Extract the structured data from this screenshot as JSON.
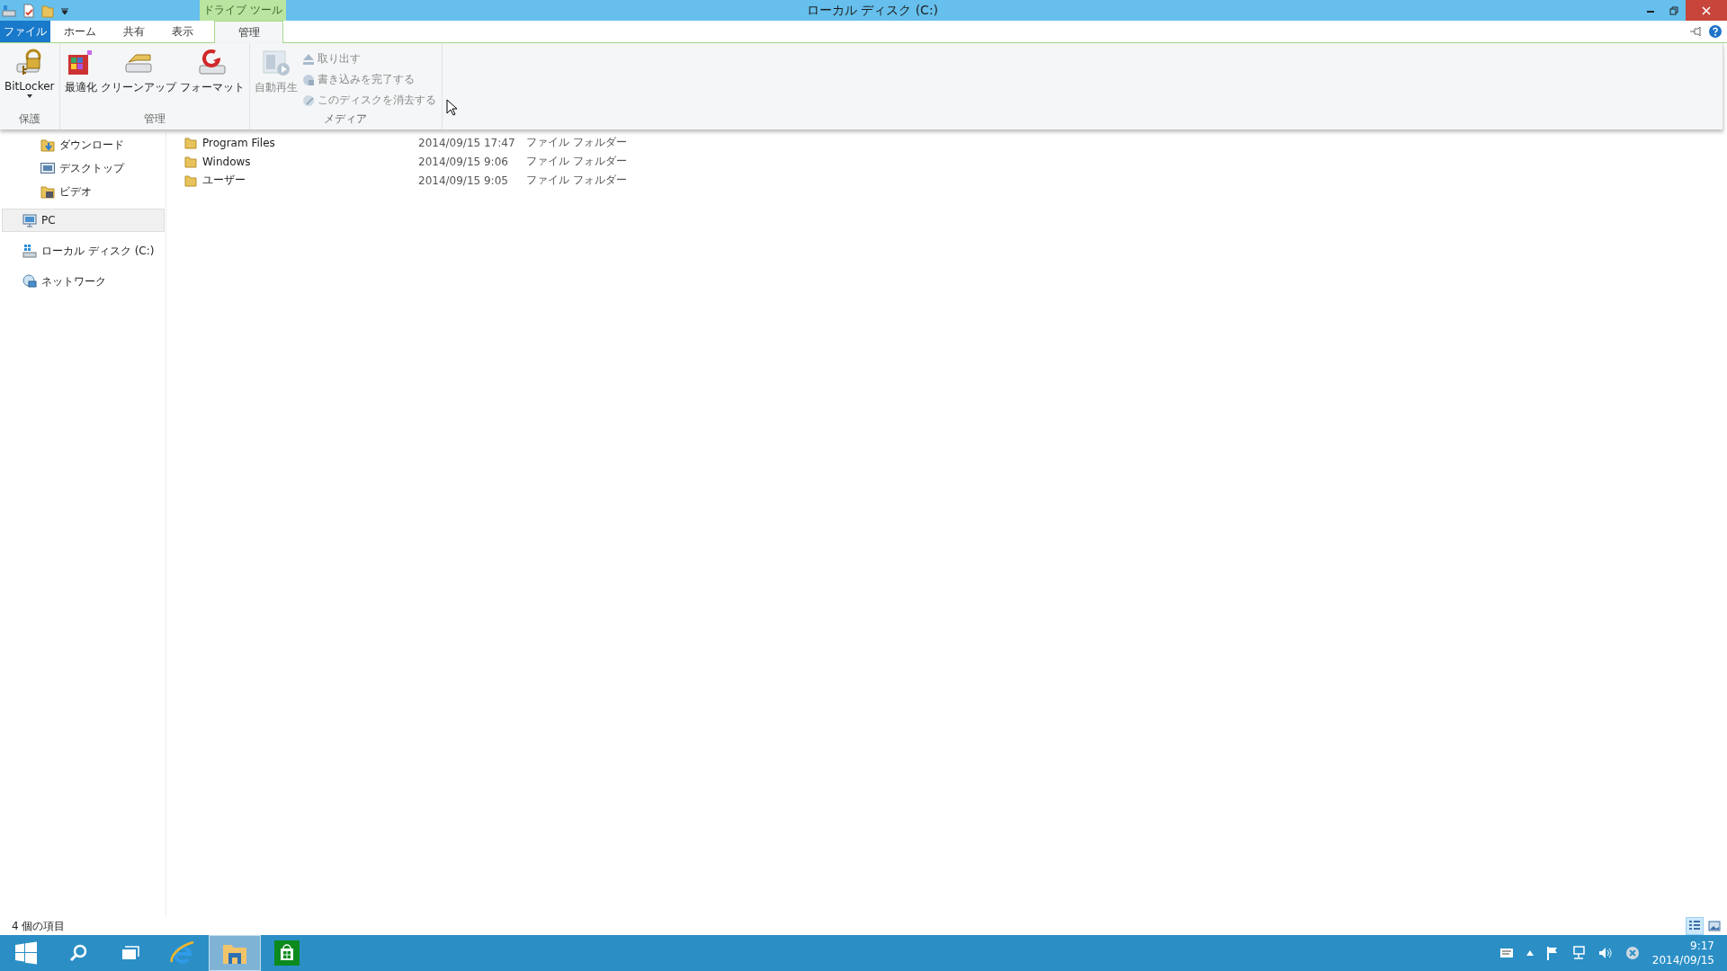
{
  "window": {
    "title": "ローカル ディスク (C:)"
  },
  "contextual_group": {
    "label": "ドライブ ツール"
  },
  "tabs": [
    {
      "label": "ファイル",
      "kind": "file",
      "selected": false
    },
    {
      "label": "ホーム",
      "kind": "tab",
      "selected": false
    },
    {
      "label": "共有",
      "kind": "tab",
      "selected": false
    },
    {
      "label": "表示",
      "kind": "tab",
      "selected": false
    },
    {
      "label": "管理",
      "kind": "contextual",
      "selected": true
    }
  ],
  "ribbon": {
    "groups": [
      {
        "label": "保護",
        "commands": [
          {
            "label": "BitLocker",
            "kind": "large",
            "dropdown": true,
            "disabled": false
          }
        ]
      },
      {
        "label": "管理",
        "commands": [
          {
            "label": "最適化",
            "kind": "large",
            "disabled": false
          },
          {
            "label": "クリーンアップ",
            "kind": "large",
            "disabled": false
          },
          {
            "label": "フォーマット",
            "kind": "large",
            "disabled": false
          }
        ]
      },
      {
        "label": "メディア",
        "commands": [
          {
            "label": "自動再生",
            "kind": "large",
            "disabled": true
          },
          {
            "label": "取り出す",
            "kind": "small",
            "disabled": true
          },
          {
            "label": "書き込みを完了する",
            "kind": "small",
            "disabled": true
          },
          {
            "label": "このディスクを消去する",
            "kind": "small",
            "disabled": true
          }
        ]
      }
    ]
  },
  "nav_pane": {
    "items": [
      {
        "children": [
          {
            "label": "ダウンロード",
            "selected": false
          },
          {
            "label": "デスクトップ",
            "selected": false
          },
          {
            "label": "ビデオ",
            "selected": false
          }
        ]
      },
      {
        "label": "PC",
        "selected": true
      },
      {
        "label": "ローカル ディスク (C:)",
        "selected": false
      },
      {
        "label": "ネットワーク",
        "selected": false
      }
    ]
  },
  "file_list": {
    "rows": [
      {
        "name": "Program Files",
        "date": "2014/09/15 17:47",
        "type": "ファイル フォルダー"
      },
      {
        "name": "Windows",
        "date": "2014/09/15 9:06",
        "type": "ファイル フォルダー"
      },
      {
        "name": "ユーザー",
        "date": "2014/09/15 9:05",
        "type": "ファイル フォルダー"
      }
    ]
  },
  "status_bar": {
    "text": "4 個の項目",
    "views": [
      {
        "kind": "details",
        "selected": true
      },
      {
        "kind": "large-icons",
        "selected": false
      }
    ]
  },
  "taskbar": {
    "apps": [
      {
        "kind": "search",
        "active": false
      },
      {
        "kind": "task-view",
        "active": false
      },
      {
        "kind": "browser",
        "active": false
      },
      {
        "kind": "explorer",
        "active": true
      },
      {
        "kind": "store",
        "active": false
      }
    ],
    "clock": {
      "time": "9:17",
      "date": "2014/09/15"
    }
  }
}
